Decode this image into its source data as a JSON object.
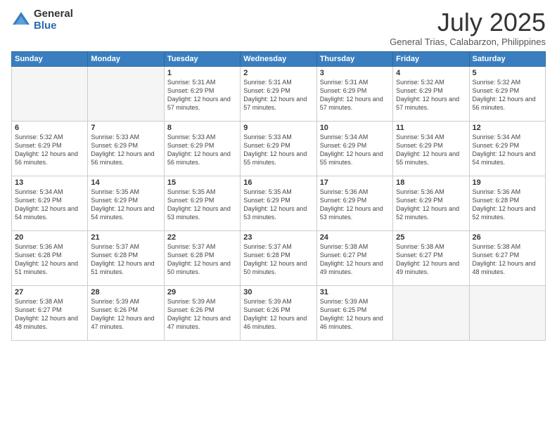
{
  "logo": {
    "general": "General",
    "blue": "Blue"
  },
  "title": "July 2025",
  "subtitle": "General Trias, Calabarzon, Philippines",
  "days_header": [
    "Sunday",
    "Monday",
    "Tuesday",
    "Wednesday",
    "Thursday",
    "Friday",
    "Saturday"
  ],
  "weeks": [
    [
      {
        "day": "",
        "info": ""
      },
      {
        "day": "",
        "info": ""
      },
      {
        "day": "1",
        "info": "Sunrise: 5:31 AM\nSunset: 6:29 PM\nDaylight: 12 hours and 57 minutes."
      },
      {
        "day": "2",
        "info": "Sunrise: 5:31 AM\nSunset: 6:29 PM\nDaylight: 12 hours and 57 minutes."
      },
      {
        "day": "3",
        "info": "Sunrise: 5:31 AM\nSunset: 6:29 PM\nDaylight: 12 hours and 57 minutes."
      },
      {
        "day": "4",
        "info": "Sunrise: 5:32 AM\nSunset: 6:29 PM\nDaylight: 12 hours and 57 minutes."
      },
      {
        "day": "5",
        "info": "Sunrise: 5:32 AM\nSunset: 6:29 PM\nDaylight: 12 hours and 56 minutes."
      }
    ],
    [
      {
        "day": "6",
        "info": "Sunrise: 5:32 AM\nSunset: 6:29 PM\nDaylight: 12 hours and 56 minutes."
      },
      {
        "day": "7",
        "info": "Sunrise: 5:33 AM\nSunset: 6:29 PM\nDaylight: 12 hours and 56 minutes."
      },
      {
        "day": "8",
        "info": "Sunrise: 5:33 AM\nSunset: 6:29 PM\nDaylight: 12 hours and 56 minutes."
      },
      {
        "day": "9",
        "info": "Sunrise: 5:33 AM\nSunset: 6:29 PM\nDaylight: 12 hours and 55 minutes."
      },
      {
        "day": "10",
        "info": "Sunrise: 5:34 AM\nSunset: 6:29 PM\nDaylight: 12 hours and 55 minutes."
      },
      {
        "day": "11",
        "info": "Sunrise: 5:34 AM\nSunset: 6:29 PM\nDaylight: 12 hours and 55 minutes."
      },
      {
        "day": "12",
        "info": "Sunrise: 5:34 AM\nSunset: 6:29 PM\nDaylight: 12 hours and 54 minutes."
      }
    ],
    [
      {
        "day": "13",
        "info": "Sunrise: 5:34 AM\nSunset: 6:29 PM\nDaylight: 12 hours and 54 minutes."
      },
      {
        "day": "14",
        "info": "Sunrise: 5:35 AM\nSunset: 6:29 PM\nDaylight: 12 hours and 54 minutes."
      },
      {
        "day": "15",
        "info": "Sunrise: 5:35 AM\nSunset: 6:29 PM\nDaylight: 12 hours and 53 minutes."
      },
      {
        "day": "16",
        "info": "Sunrise: 5:35 AM\nSunset: 6:29 PM\nDaylight: 12 hours and 53 minutes."
      },
      {
        "day": "17",
        "info": "Sunrise: 5:36 AM\nSunset: 6:29 PM\nDaylight: 12 hours and 53 minutes."
      },
      {
        "day": "18",
        "info": "Sunrise: 5:36 AM\nSunset: 6:29 PM\nDaylight: 12 hours and 52 minutes."
      },
      {
        "day": "19",
        "info": "Sunrise: 5:36 AM\nSunset: 6:28 PM\nDaylight: 12 hours and 52 minutes."
      }
    ],
    [
      {
        "day": "20",
        "info": "Sunrise: 5:36 AM\nSunset: 6:28 PM\nDaylight: 12 hours and 51 minutes."
      },
      {
        "day": "21",
        "info": "Sunrise: 5:37 AM\nSunset: 6:28 PM\nDaylight: 12 hours and 51 minutes."
      },
      {
        "day": "22",
        "info": "Sunrise: 5:37 AM\nSunset: 6:28 PM\nDaylight: 12 hours and 50 minutes."
      },
      {
        "day": "23",
        "info": "Sunrise: 5:37 AM\nSunset: 6:28 PM\nDaylight: 12 hours and 50 minutes."
      },
      {
        "day": "24",
        "info": "Sunrise: 5:38 AM\nSunset: 6:27 PM\nDaylight: 12 hours and 49 minutes."
      },
      {
        "day": "25",
        "info": "Sunrise: 5:38 AM\nSunset: 6:27 PM\nDaylight: 12 hours and 49 minutes."
      },
      {
        "day": "26",
        "info": "Sunrise: 5:38 AM\nSunset: 6:27 PM\nDaylight: 12 hours and 48 minutes."
      }
    ],
    [
      {
        "day": "27",
        "info": "Sunrise: 5:38 AM\nSunset: 6:27 PM\nDaylight: 12 hours and 48 minutes."
      },
      {
        "day": "28",
        "info": "Sunrise: 5:39 AM\nSunset: 6:26 PM\nDaylight: 12 hours and 47 minutes."
      },
      {
        "day": "29",
        "info": "Sunrise: 5:39 AM\nSunset: 6:26 PM\nDaylight: 12 hours and 47 minutes."
      },
      {
        "day": "30",
        "info": "Sunrise: 5:39 AM\nSunset: 6:26 PM\nDaylight: 12 hours and 46 minutes."
      },
      {
        "day": "31",
        "info": "Sunrise: 5:39 AM\nSunset: 6:25 PM\nDaylight: 12 hours and 46 minutes."
      },
      {
        "day": "",
        "info": ""
      },
      {
        "day": "",
        "info": ""
      }
    ]
  ]
}
